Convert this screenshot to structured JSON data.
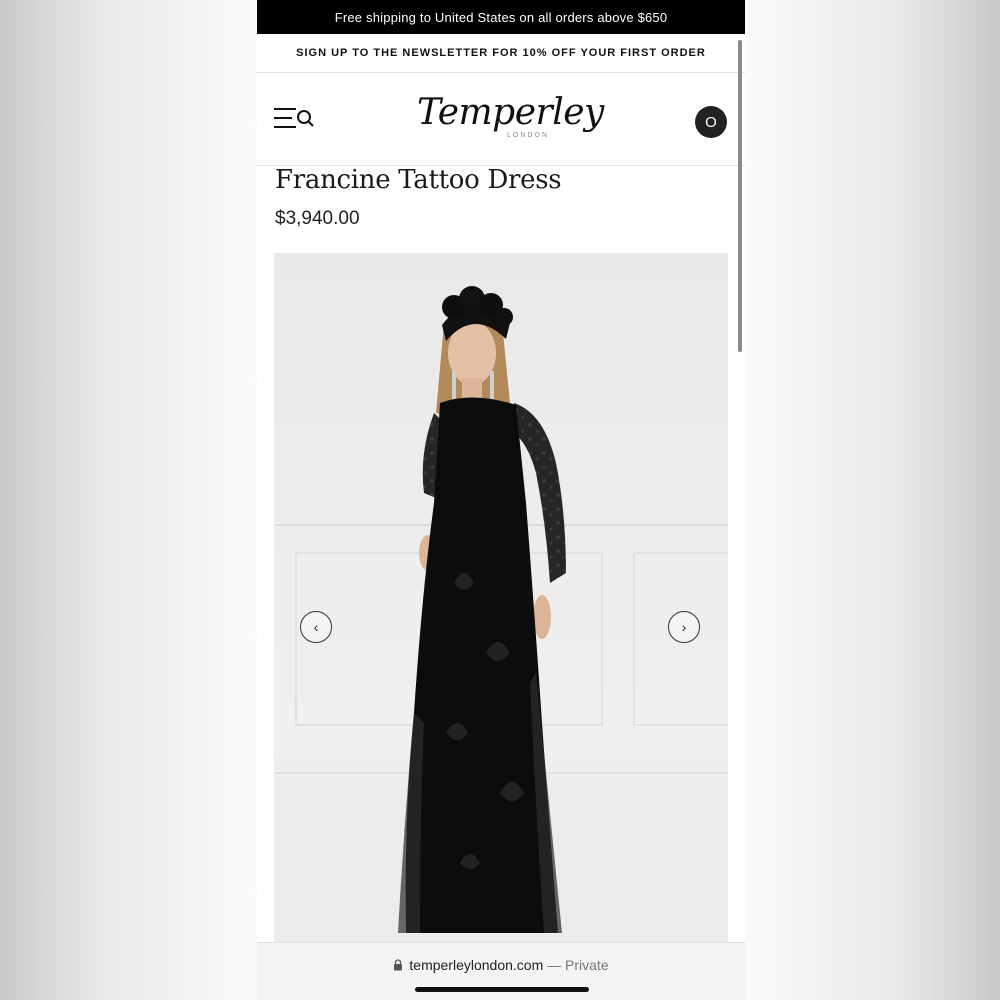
{
  "promo": {
    "shipping_text": "Free shipping to United States on all orders above $650"
  },
  "newsletter": {
    "text": "SIGN UP TO THE NEWSLETTER FOR 10% OFF YOUR FIRST ORDER"
  },
  "header": {
    "logo_text": "Temperley",
    "logo_subtext": "LONDON",
    "menu_icon": "menu-search-icon",
    "account_label": "O"
  },
  "product": {
    "title": "Francine Tattoo Dress",
    "price": "$3,940.00"
  },
  "gallery": {
    "prev_label": "‹",
    "next_label": "›"
  },
  "browser": {
    "url": "temperleylondon.com",
    "mode": "— Private"
  },
  "colors": {
    "promo_bg": "#000000",
    "account_bg": "#222222",
    "dress": "#0b0b0b"
  }
}
